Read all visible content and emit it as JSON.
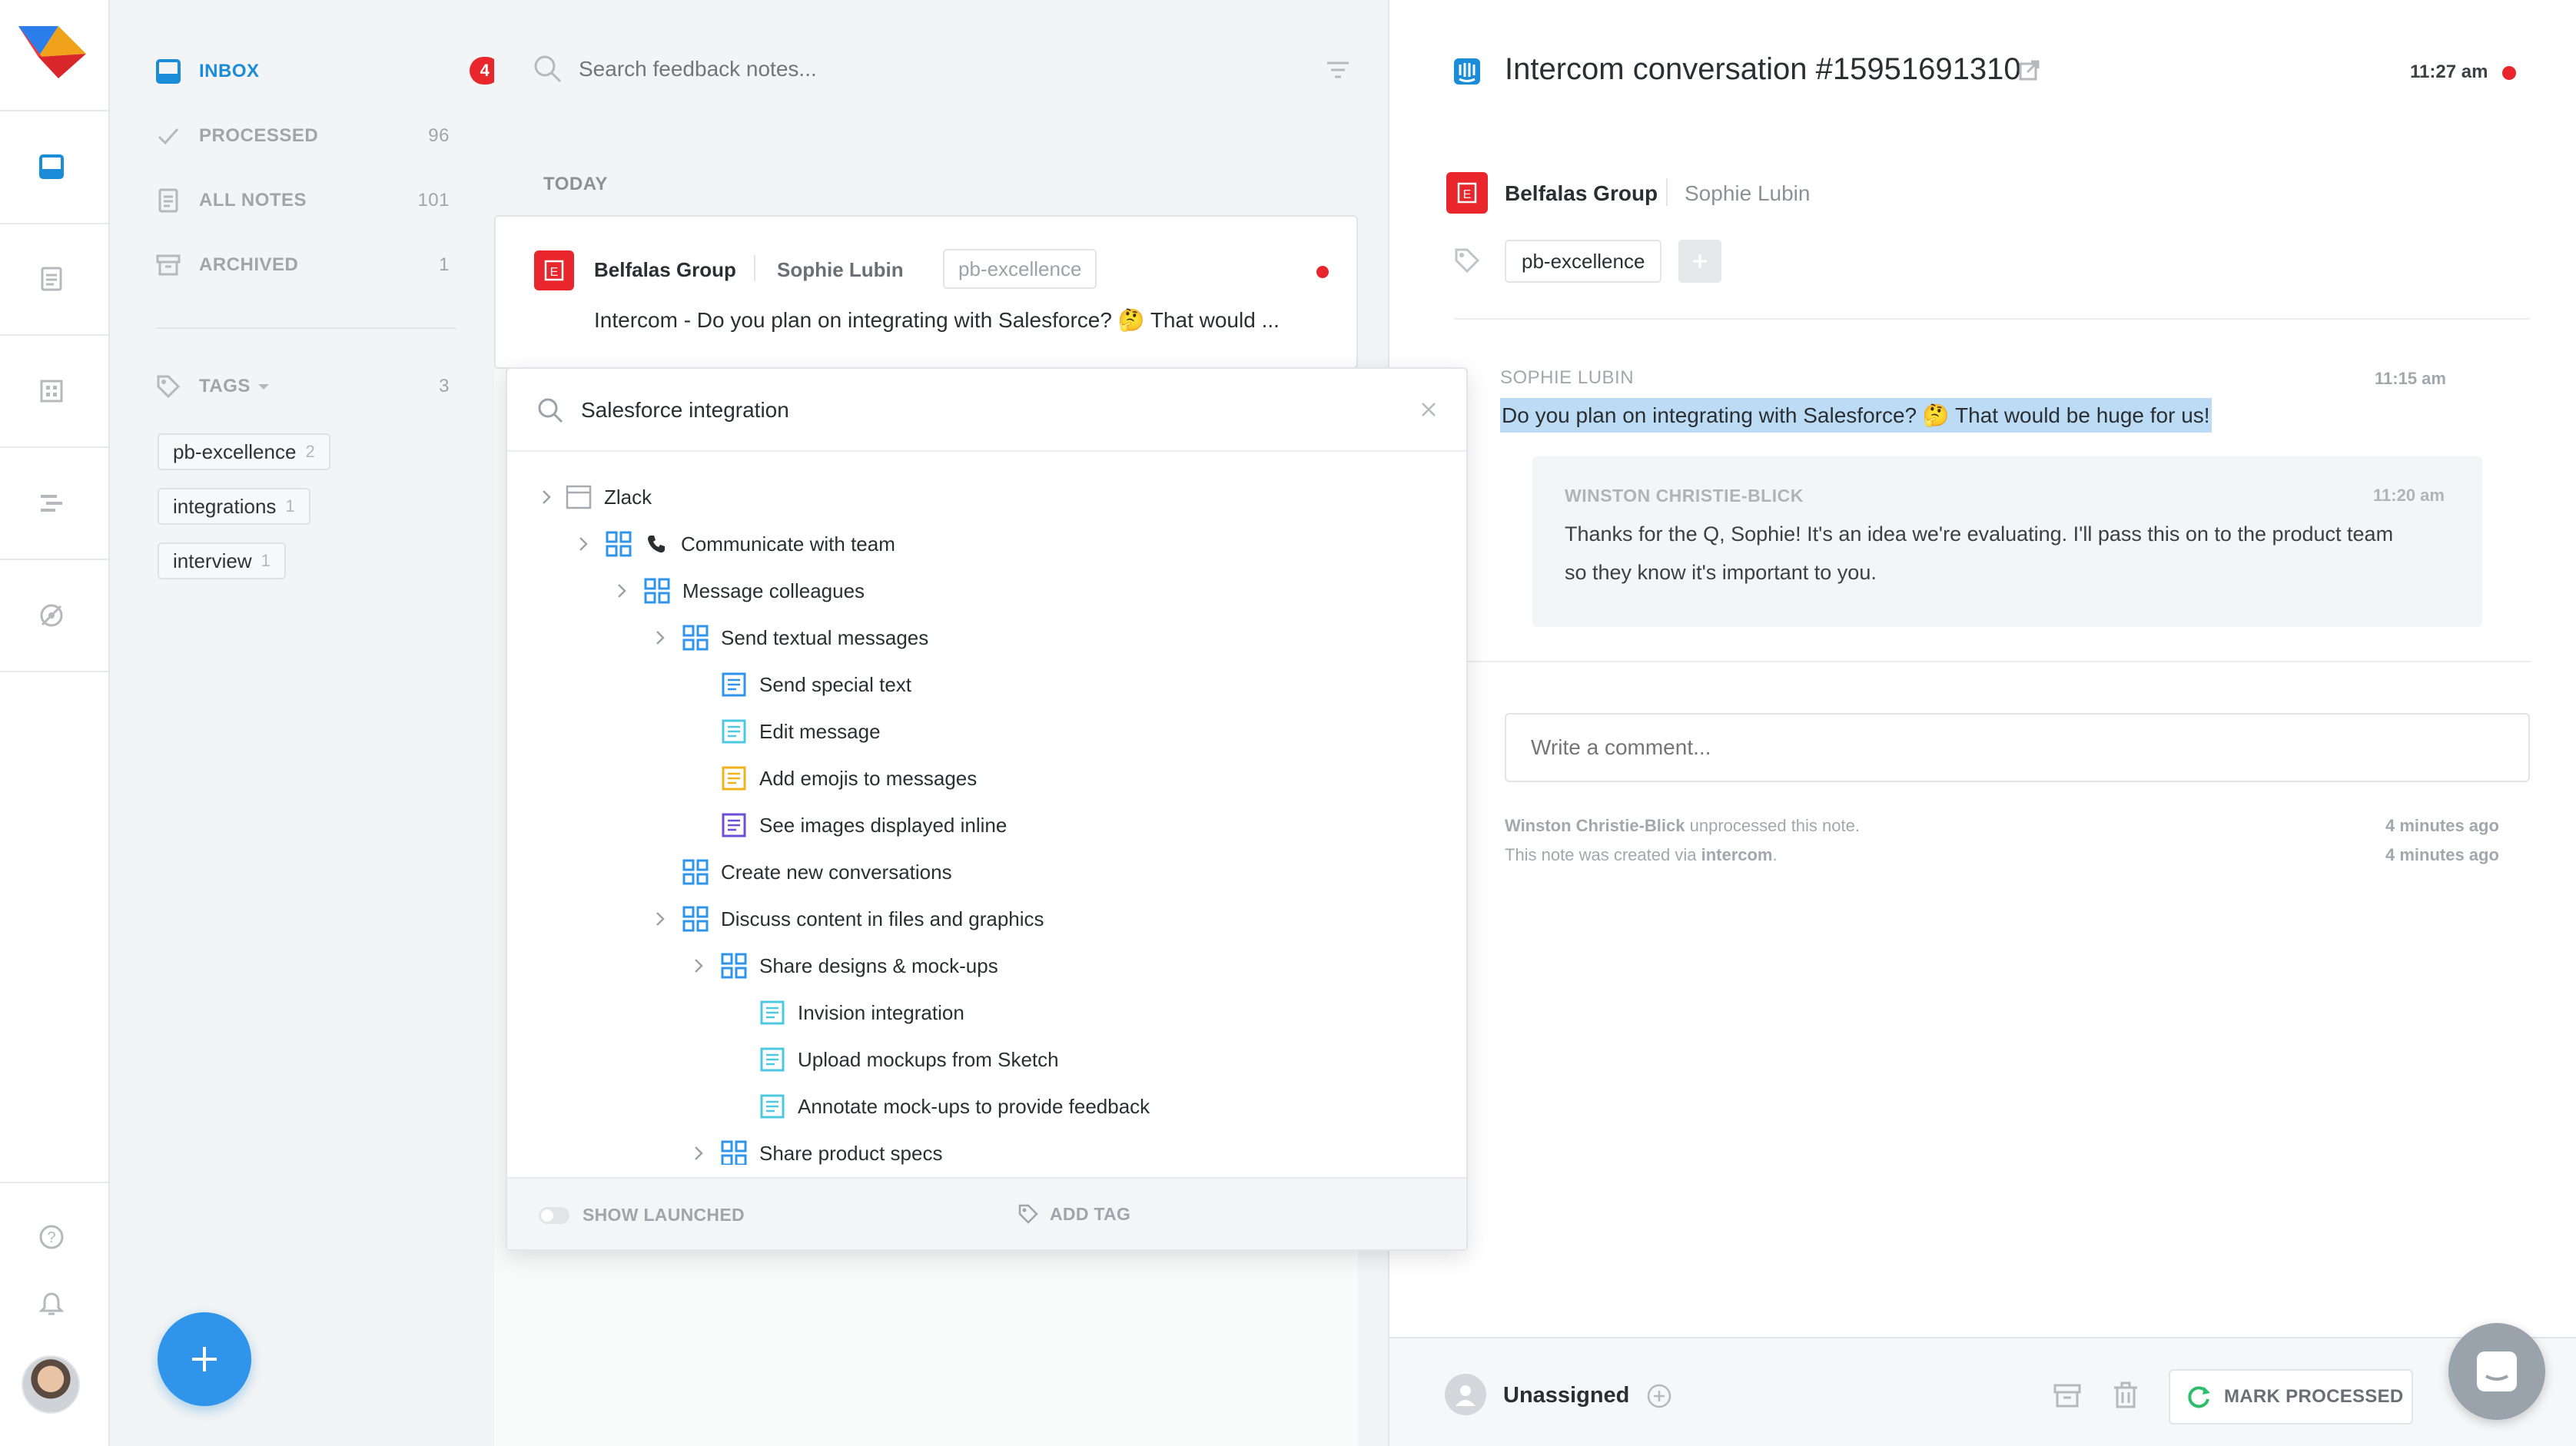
{
  "app": {
    "name": "productboard"
  },
  "rail": {
    "items": [
      "inbox",
      "notes",
      "board",
      "roadmap",
      "insights"
    ],
    "bottom": [
      "help",
      "notifications",
      "profile"
    ]
  },
  "sidebar": {
    "nav": [
      {
        "label": "INBOX",
        "count": "4",
        "active": true
      },
      {
        "label": "PROCESSED",
        "count": "96"
      },
      {
        "label": "ALL NOTES",
        "count": "101"
      },
      {
        "label": "ARCHIVED",
        "count": "1"
      }
    ],
    "tags_header": {
      "label": "TAGS",
      "count": "3"
    },
    "tags": [
      {
        "label": "pb-excellence",
        "count": "2"
      },
      {
        "label": "integrations",
        "count": "1"
      },
      {
        "label": "interview",
        "count": "1"
      }
    ],
    "fab_icon": "plus-icon"
  },
  "list": {
    "search_placeholder": "Search feedback notes...",
    "section_label": "TODAY",
    "card": {
      "company": "Belfalas Group",
      "person": "Sophie Lubin",
      "tag": "pb-excellence",
      "snippet": "Intercom - Do you plan on integrating with Salesforce? 🤔 That would ..."
    }
  },
  "dropdown": {
    "search_value": "Salesforce integration",
    "tree": [
      {
        "label": "Zlack",
        "type": "product"
      },
      {
        "label": "Communicate with team",
        "type": "component"
      },
      {
        "label": "Message colleagues",
        "type": "component"
      },
      {
        "label": "Send textual messages",
        "type": "component"
      },
      {
        "label": "Send special text",
        "type": "feature"
      },
      {
        "label": "Edit message",
        "type": "feature"
      },
      {
        "label": "Add emojis to messages",
        "type": "feature"
      },
      {
        "label": "See images displayed inline",
        "type": "feature"
      },
      {
        "label": "Create new conversations",
        "type": "component"
      },
      {
        "label": "Discuss content in files and graphics",
        "type": "component"
      },
      {
        "label": "Share designs & mock-ups",
        "type": "component"
      },
      {
        "label": "Invision integration",
        "type": "feature"
      },
      {
        "label": "Upload mockups from Sketch",
        "type": "feature"
      },
      {
        "label": "Annotate mock-ups to provide feedback",
        "type": "feature"
      },
      {
        "label": "Share product specs",
        "type": "component"
      }
    ],
    "footer": {
      "show_launched": "SHOW LAUNCHED",
      "add_tag": "ADD TAG"
    }
  },
  "detail": {
    "title": "Intercom conversation #15951691310",
    "time": "11:27 am",
    "company": "Belfalas Group",
    "person": "Sophie Lubin",
    "tag": "pb-excellence",
    "add_tag_icon": "plus-icon",
    "messages": [
      {
        "author": "SOPHIE LUBIN",
        "time": "11:15 am",
        "text": "Do you plan on integrating with Salesforce? 🤔 That would be huge for us!"
      },
      {
        "author": "WINSTON CHRISTIE-BLICK",
        "time": "11:20 am",
        "text_line1": "Thanks for the Q, Sophie! It's an idea we're evaluating. I'll pass this on to the product team",
        "text_line2": "so they know it's important to you."
      }
    ],
    "comment_placeholder": "Write a comment...",
    "activity": [
      {
        "actor": "Winston Christie-Blick",
        "action": " unprocessed this note.",
        "when": "4 minutes ago"
      },
      {
        "prefix": "This note was created via ",
        "source": "intercom",
        "suffix": ".",
        "when": "4 minutes ago"
      }
    ],
    "footer": {
      "assignee": "Unassigned",
      "mark_processed": "MARK PROCESSED"
    }
  },
  "colors": {
    "accent": "#1a8cd8",
    "danger": "#e8262b",
    "processed_green": "#2ebd6b"
  }
}
